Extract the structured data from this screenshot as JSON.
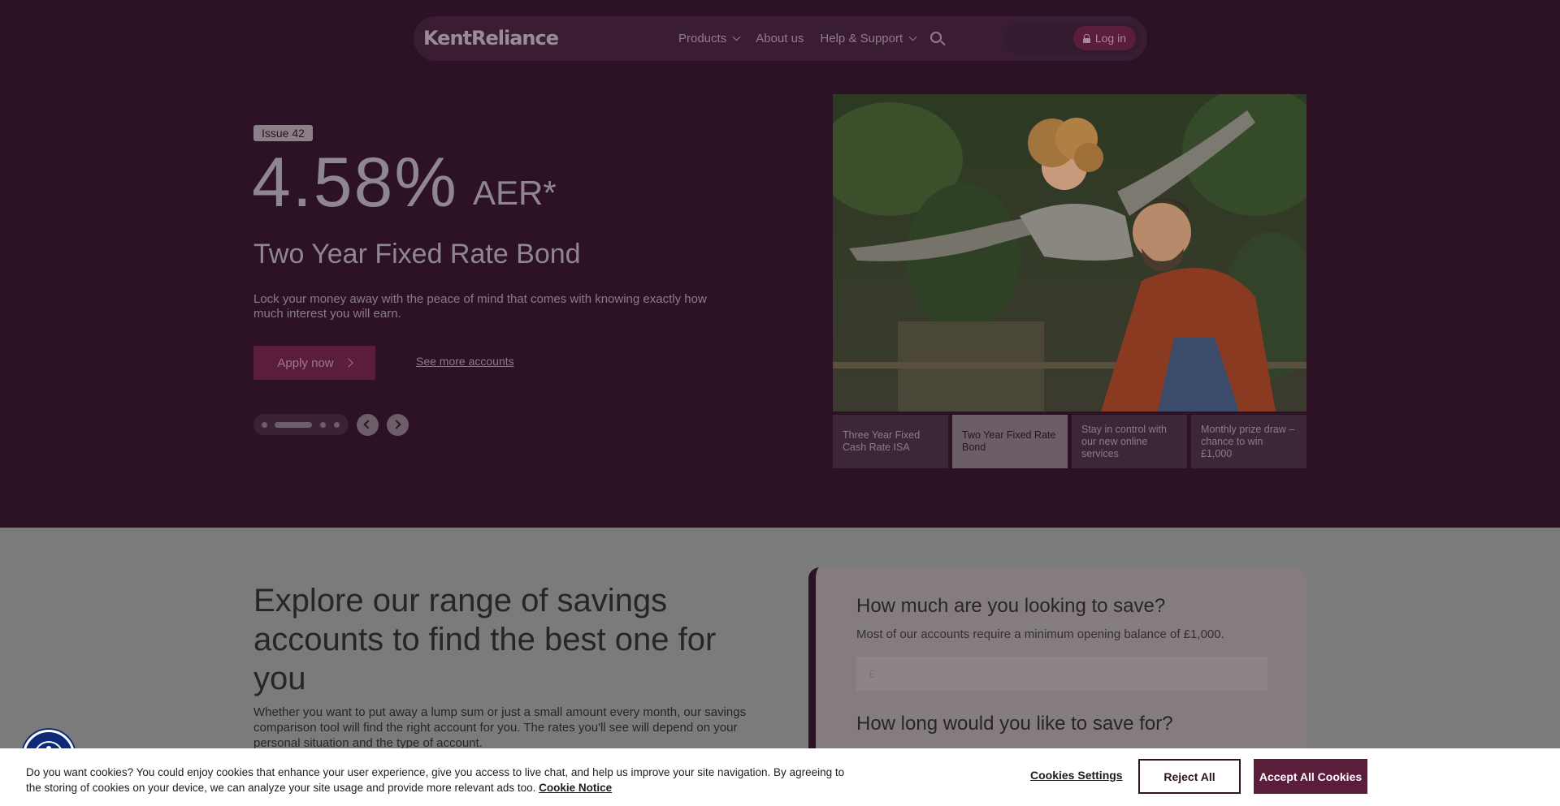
{
  "nav": {
    "logo": "KentReliance",
    "links": [
      {
        "label": "Products",
        "has_dropdown": true
      },
      {
        "label": "About us",
        "has_dropdown": false
      },
      {
        "label": "Help & Support",
        "has_dropdown": true
      }
    ],
    "search_icon": "search-icon",
    "login_label": "Log in"
  },
  "hero": {
    "issue_badge": "Issue 42",
    "rate": "4.58%",
    "rate_suffix": "AER*",
    "title": "Two Year Fixed Rate Bond",
    "description": "Lock your money away with the peace of mind that comes with knowing exactly how much interest you will earn.",
    "apply_label": "Apply now",
    "see_more_label": "See more accounts",
    "carousel": {
      "slide_count": 4,
      "active_index": 1
    },
    "tabs": [
      {
        "label": "Three Year Fixed Cash Rate ISA",
        "active": false
      },
      {
        "label": "Two Year Fixed Rate Bond",
        "active": true
      },
      {
        "label": "Stay in control with our new online services",
        "active": false
      },
      {
        "label": "Monthly prize draw – chance to win £1,000",
        "active": false
      }
    ]
  },
  "explore": {
    "title": "Explore our range of savings accounts to find the best one for you",
    "description": "Whether you want to put away a lump sum or just a small amount every month, our savings comparison tool will find the right account for you. The rates you'll see will depend on your personal situation and the type of account."
  },
  "calculator": {
    "question1": "How much are you looking to save?",
    "subtext": "Most of our accounts require a minimum opening balance of £1,000.",
    "input_prefix": "£",
    "question2": "How long would you like to save for?"
  },
  "cookie_banner": {
    "text": "Do you want cookies? You could enjoy cookies that enhance your user experience, give you access to live chat, and help us improve your site navigation. By agreeing to the storing of cookies on your device, we can analyze your site usage and provide more relevant ads too.",
    "notice_link": "Cookie Notice",
    "settings_label": "Cookies Settings",
    "reject_label": "Reject All",
    "accept_label": "Accept All Cookies"
  },
  "colors": {
    "hero_bg": "#2d1226",
    "brand": "#5a1d3a",
    "overlay": "#7b7b7b"
  }
}
